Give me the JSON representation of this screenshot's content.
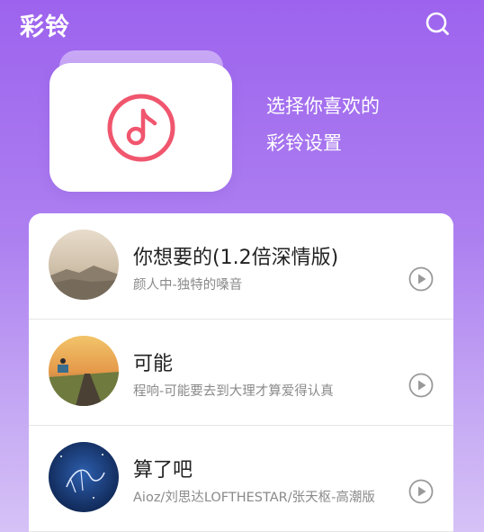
{
  "header": {
    "title": "彩铃",
    "search_icon": "search-icon"
  },
  "hero": {
    "line1": "选择你喜欢的",
    "line2": "彩铃设置",
    "icon": "music-note-icon",
    "icon_color": "#f0566e"
  },
  "colors": {
    "bg_top": "#9d63ee",
    "bg_bottom": "#d6c2f6"
  },
  "songs": [
    {
      "title": "你想要的(1.2倍深情版)",
      "subtitle": "颜人中-独特的嗓音",
      "play_icon": "play-icon"
    },
    {
      "title": "可能",
      "subtitle": "程响-可能要去到大理才算爱得认真",
      "play_icon": "play-icon"
    },
    {
      "title": "算了吧",
      "subtitle": "Aioz/刘思达LOFTHESTAR/张天枢-高潮版",
      "play_icon": "play-icon"
    }
  ]
}
